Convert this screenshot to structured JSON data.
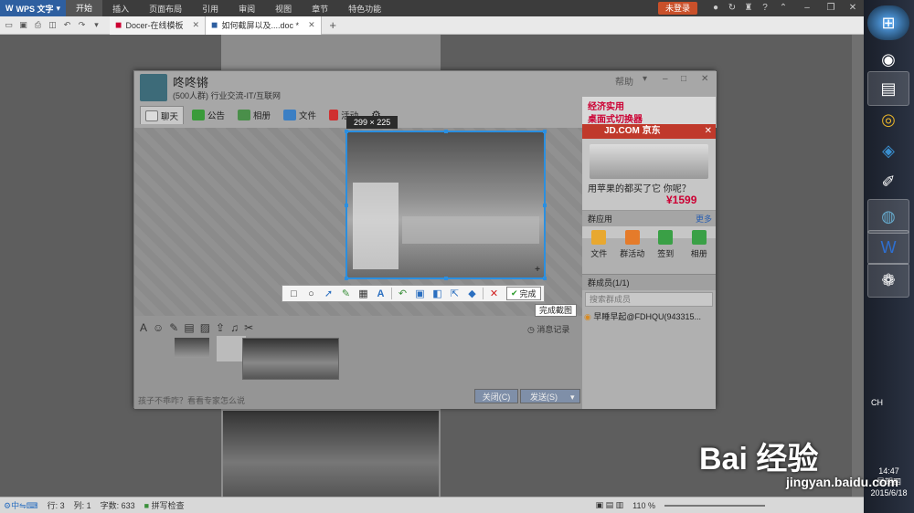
{
  "wps": {
    "app_name": "WPS 文字",
    "menu": [
      "开始",
      "插入",
      "页面布局",
      "引用",
      "审阅",
      "视图",
      "章节",
      "特色功能"
    ],
    "login": "未登录",
    "tabs": [
      {
        "label": "Docer-在线模板"
      },
      {
        "label": "如何截屏以及....doc *"
      }
    ],
    "status": {
      "row": "行: 3",
      "col": "列: 1",
      "words": "字数: 633",
      "spell": "拼写检查",
      "zoom": "110 %"
    }
  },
  "qq": {
    "group_name": "咚咚锵",
    "group_sub": "(500人群) 行业交流-IT/互联网",
    "win_help": "帮助",
    "tabs": [
      {
        "label": "聊天",
        "icon": "chat-icon",
        "color": "#dcdcdc"
      },
      {
        "label": "公告",
        "icon": "flag-icon",
        "color": "#3a9b3a"
      },
      {
        "label": "相册",
        "icon": "photo-icon",
        "color": "#4a8f4a"
      },
      {
        "label": "文件",
        "icon": "folder-icon",
        "color": "#3b7fc4"
      },
      {
        "label": "活动",
        "icon": "red-flag-icon",
        "color": "#d03030"
      }
    ],
    "tip": "孩子不乖咋？看看专家怎么说",
    "msg_record": "消息记录",
    "close_label": "关闭(C)",
    "send_label": "发送(S)",
    "ad": {
      "line1": "经济实用",
      "line2": "桌面式切换器",
      "jd": "JD.COM 京东",
      "slogan": "用苹果的都买了它  你呢？",
      "price": "¥1599"
    },
    "apps_header": "群应用",
    "apps_more": "更多",
    "apps": [
      {
        "label": "文件",
        "color": "#e8a830"
      },
      {
        "label": "群活动",
        "color": "#e57b2a"
      },
      {
        "label": "签到",
        "color": "#3aa046"
      },
      {
        "label": "相册",
        "color": "#3aa046"
      }
    ],
    "members_header": "群成员(1/1)",
    "member_search": "搜索群成员",
    "member": "早睡早起@FDHQU(943315..."
  },
  "capture": {
    "size": "299 × 225",
    "done": "完成",
    "tooltip": "完成截图",
    "tools": [
      "rect-tool",
      "ellipse-tool",
      "arrow-tool",
      "pen-tool",
      "mosaic-tool",
      "text-tool",
      "undo-tool",
      "save-tool",
      "copy-tool",
      "share-tool",
      "pin-tool",
      "cancel-tool"
    ]
  },
  "taskbar": {
    "apps": [
      "start",
      "app-360",
      "app-explorer",
      "app-chrome",
      "app-baidu",
      "app-paint",
      "app-qq",
      "app-wps",
      "app-palette"
    ],
    "ime": "CH",
    "time": "14:47",
    "weekday": "星期四",
    "date": "2015/6/18"
  },
  "watermark": {
    "logo": "Bai 经验",
    "url": "jingyan.baidu.com"
  }
}
